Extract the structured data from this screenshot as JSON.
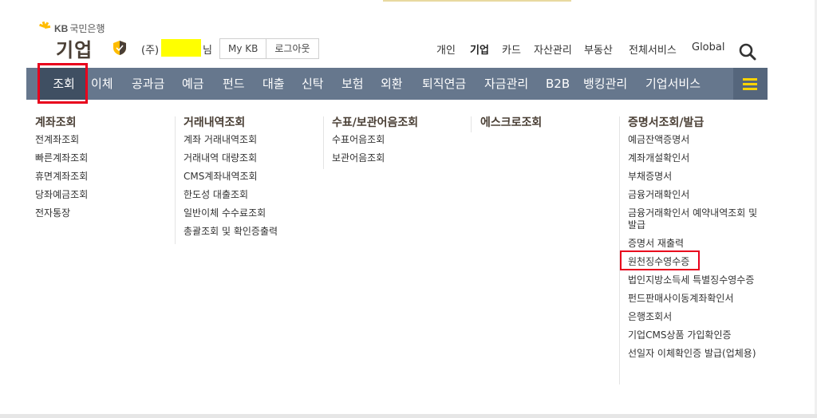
{
  "logo": {
    "brand": "KB",
    "bank_name": "국민은행",
    "title": "기업"
  },
  "user": {
    "prefix": "(주)",
    "suffix": "님"
  },
  "header_buttons": [
    {
      "label": "My KB"
    },
    {
      "label": "로그아웃"
    }
  ],
  "util_nav": [
    {
      "label": "개인",
      "active": false
    },
    {
      "label": "기업",
      "active": true
    },
    {
      "label": "카드",
      "active": false
    },
    {
      "label": "자산관리",
      "active": false
    },
    {
      "label": "부동산",
      "active": false
    },
    {
      "label": "전체서비스",
      "active": false
    },
    {
      "label": "Global",
      "active": false
    }
  ],
  "main_nav": [
    {
      "label": "조회",
      "active": true
    },
    {
      "label": "이체"
    },
    {
      "label": "공과금"
    },
    {
      "label": "예금"
    },
    {
      "label": "펀드"
    },
    {
      "label": "대출"
    },
    {
      "label": "신탁"
    },
    {
      "label": "보험"
    },
    {
      "label": "외환"
    },
    {
      "label": "퇴직연금"
    },
    {
      "label": "자금관리"
    },
    {
      "label": "B2B"
    },
    {
      "label": "뱅킹관리"
    },
    {
      "label": "기업서비스"
    }
  ],
  "menu_columns": [
    {
      "title": "계좌조회",
      "items": [
        "전계좌조회",
        "빠른계좌조회",
        "휴면계좌조회",
        "당좌예금조회",
        "전자통장"
      ]
    },
    {
      "title": "거래내역조회",
      "items": [
        "계좌 거래내역조회",
        "거래내역 대량조회",
        "CMS계좌내역조회",
        "한도성 대출조회",
        "일반이체 수수료조회",
        "총괄조회 및 확인증출력"
      ]
    },
    {
      "title": "수표/보관어음조회",
      "items": [
        "수표어음조회",
        "보관어음조회"
      ]
    },
    {
      "title": "에스크로조회",
      "items": []
    },
    {
      "title": "증명서조회/발급",
      "items": [
        "예금잔액증명서",
        "계좌개설확인서",
        "부채증명서",
        "금융거래확인서",
        "금융거래확인서 예약내역조회 및 발급",
        "증명서 재출력",
        "원천징수영수증",
        "법인지방소득세 특별징수영수증",
        "펀드판매사이동계좌확인서",
        "은행조회서",
        "기업CMS상품 가입확인증",
        "선일자 이체확인증 발급(업체용)"
      ]
    }
  ],
  "colors": {
    "nav_bg": "#66778d",
    "nav_active_bg": "#3f4f62",
    "highlight": "#e8001c",
    "brand_yellow": "#ffbc00",
    "menu_icon": "#ffd400"
  }
}
